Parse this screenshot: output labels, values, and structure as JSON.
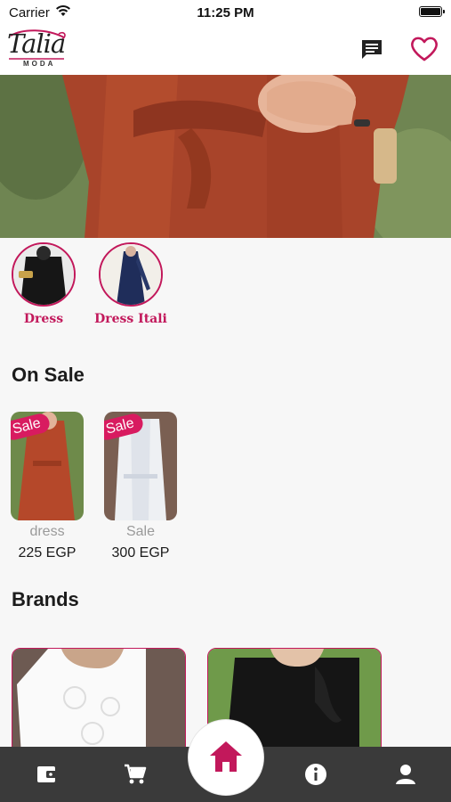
{
  "status_bar": {
    "carrier": "Carrier",
    "time": "11:25 PM"
  },
  "brand": {
    "logo_text": "Talia",
    "logo_subtext": "MODA"
  },
  "header": {
    "icons": [
      "chat-icon",
      "heart-icon"
    ]
  },
  "categories": [
    {
      "label": "Dress"
    },
    {
      "label": "Dress Itali"
    }
  ],
  "on_sale": {
    "title": "On Sale",
    "products": [
      {
        "tag": "Sale",
        "name": "dress",
        "price": "225 EGP"
      },
      {
        "tag": "Sale",
        "name": "Sale",
        "price": "300 EGP"
      }
    ]
  },
  "brands": {
    "title": "Brands"
  },
  "bottom_nav": {
    "items": [
      "wallet-icon",
      "cart-icon",
      "home-icon",
      "info-icon",
      "profile-icon"
    ]
  },
  "colors": {
    "accent": "#c2185b",
    "sale_tag": "#d81b60",
    "nav_bg": "#3a3a3a"
  }
}
